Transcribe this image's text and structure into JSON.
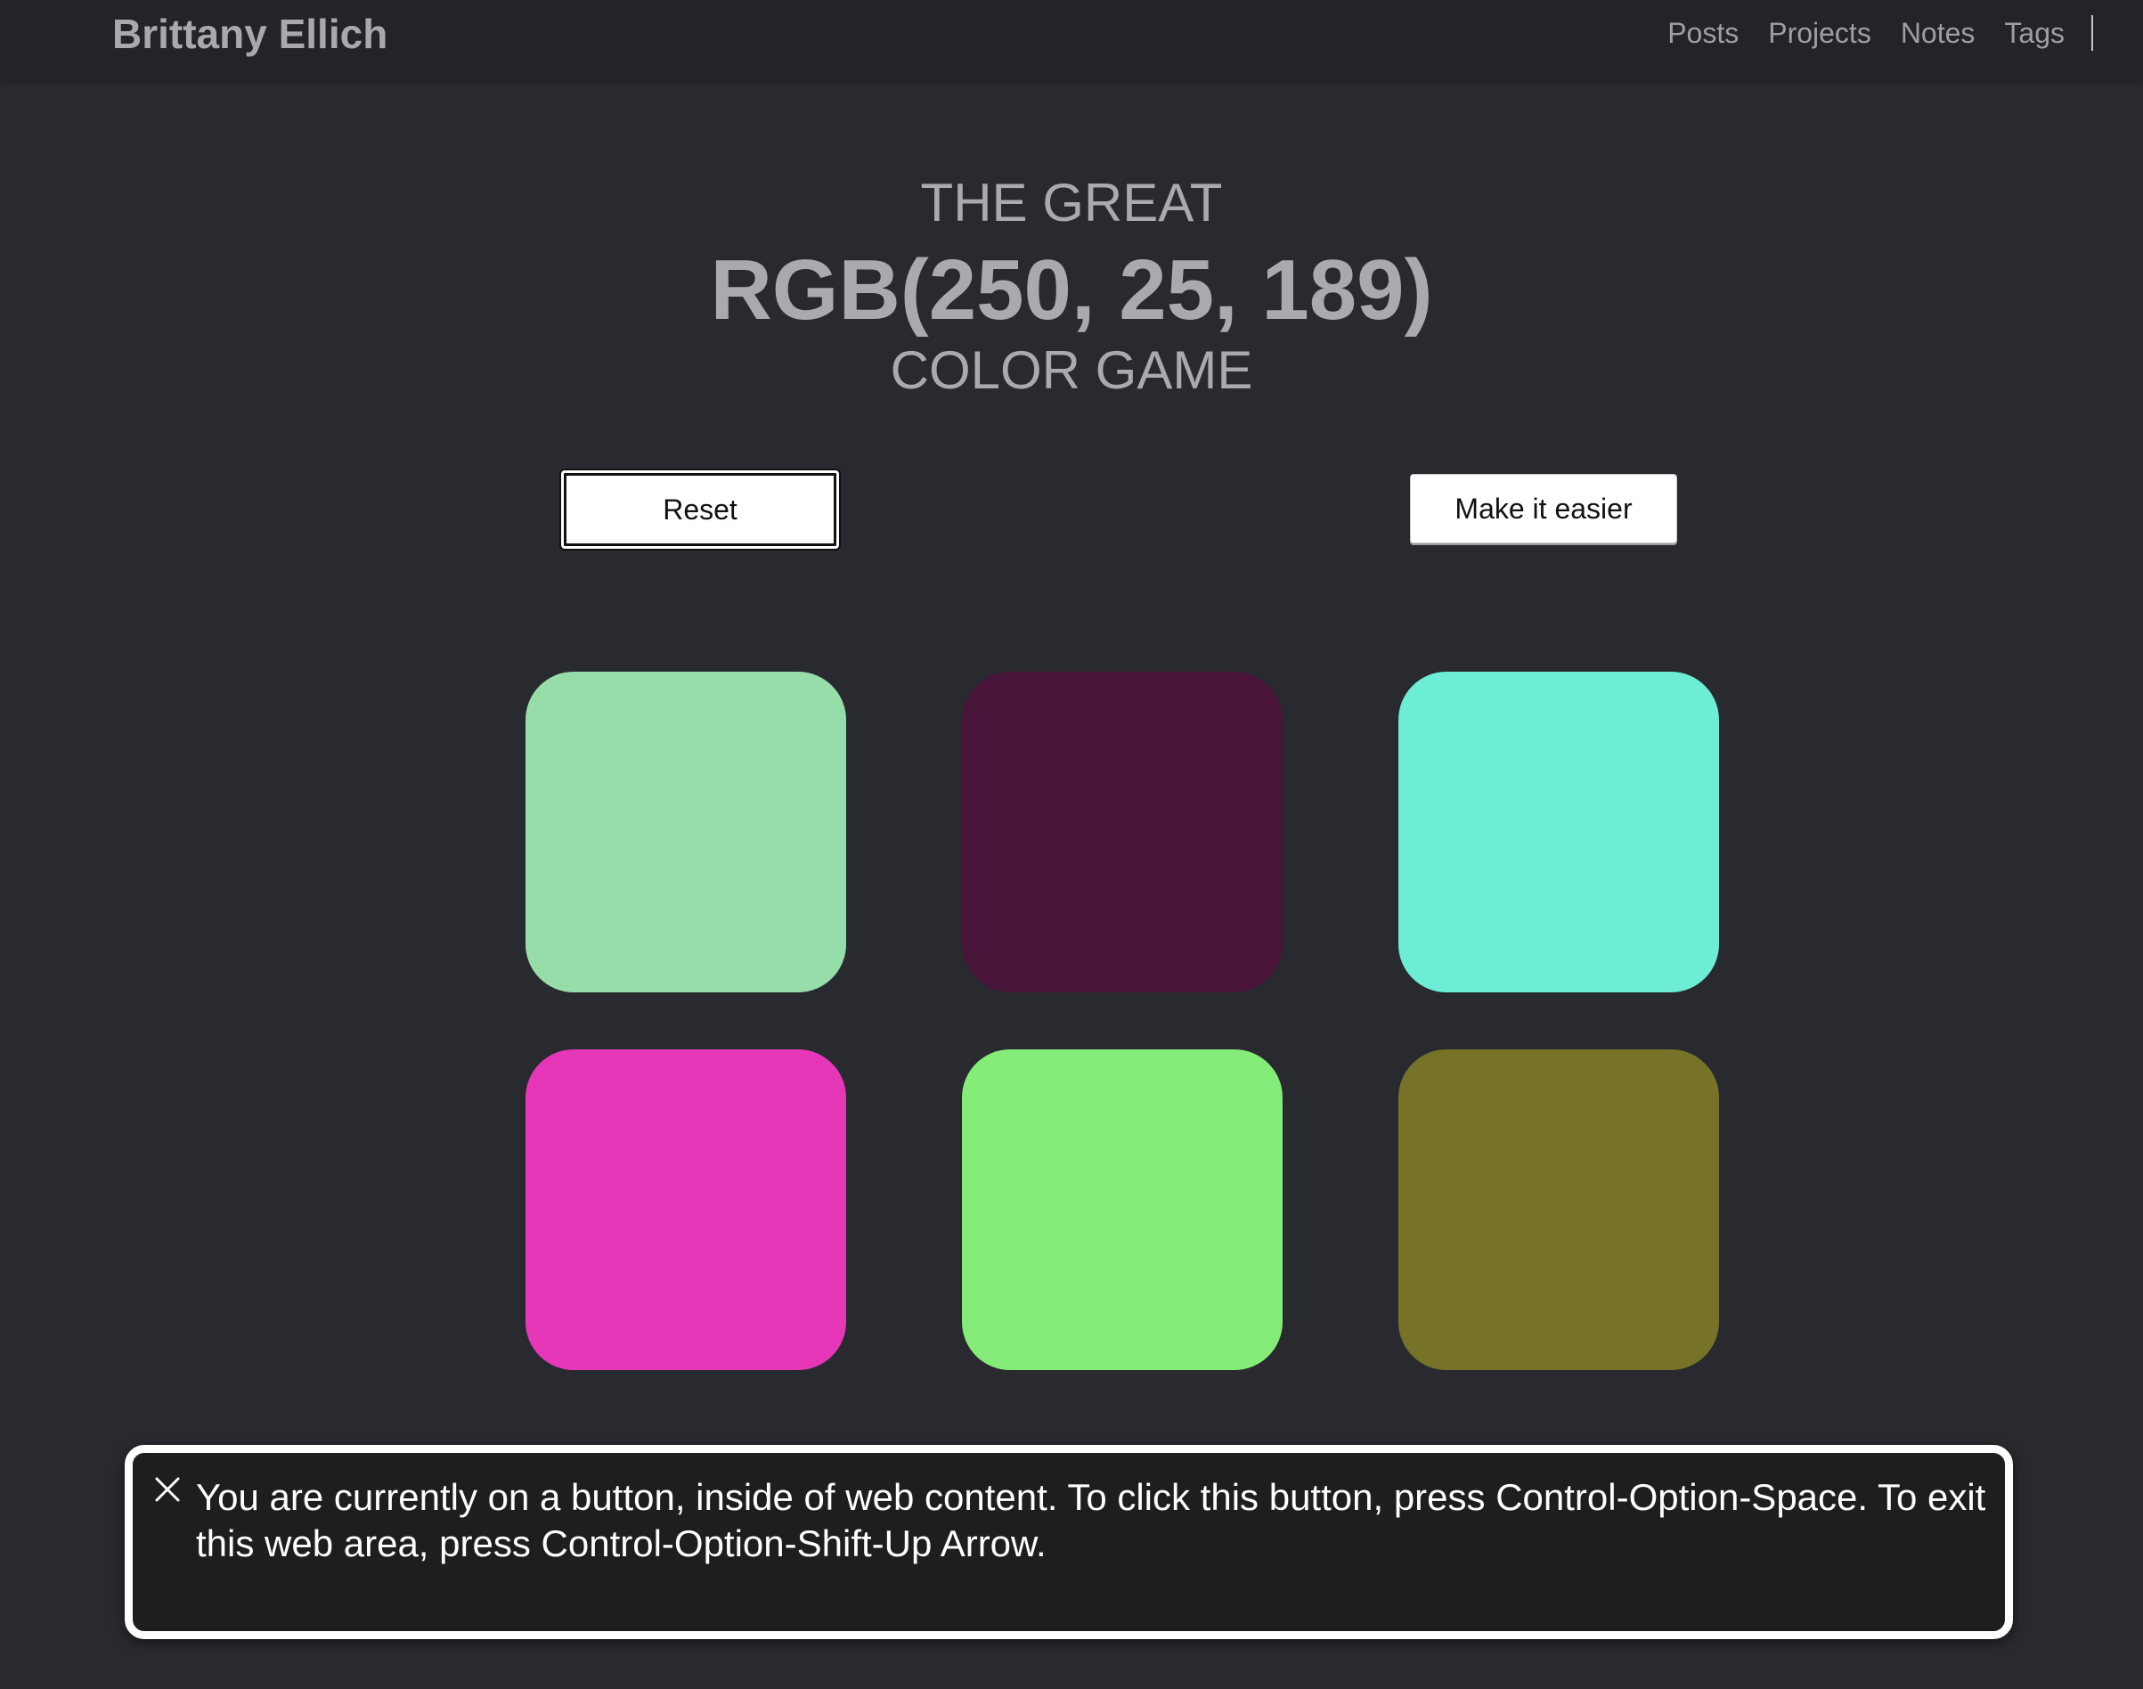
{
  "header": {
    "site_title": "Brittany Ellich",
    "nav": [
      "Posts",
      "Projects",
      "Notes",
      "Tags"
    ]
  },
  "game": {
    "title_top": "THE GREAT",
    "title_rgb": "RGB(250, 25, 189)",
    "title_bottom": "COLOR GAME",
    "reset_label": "Reset",
    "easier_label": "Make it easier",
    "swatches": [
      "#97dda9",
      "#48143a",
      "#6eedd6",
      "#e637b8",
      "#86ec79",
      "#767329"
    ]
  },
  "voiceover": {
    "message": "You are currently on a button, inside of web content. To click this button, press Control-Option-Space. To exit this web area, press Control-Option-Shift-Up Arrow.",
    "close_icon": "close-icon"
  },
  "colors": {
    "background": "#292a2f",
    "navbar": "#232428",
    "title_text": "#a9a9b0"
  }
}
